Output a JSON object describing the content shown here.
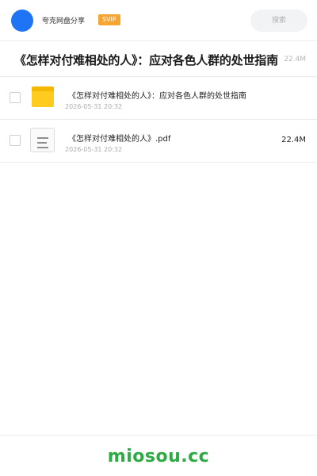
{
  "header": {
    "brand": "夸克网盘分享",
    "badge": "SVIP",
    "search_placeholder": "搜索"
  },
  "share": {
    "title": "《怎样对付难相处的人》：应对各色人群的处世指南",
    "total_size": "22.4M"
  },
  "files": [
    {
      "name": "《怎样对付难相处的人》：应对各色人群的处世指南",
      "date": "2026-05-31 20:32",
      "size": "",
      "type": "folder"
    },
    {
      "name": "《怎样对付难相处的人》.pdf",
      "date": "2026-05-31 20:32",
      "size": "22.4M",
      "type": "document"
    }
  ],
  "footer": {
    "watermark": "miosou.cc"
  },
  "colors": {
    "accent": "#1f74f6",
    "badge": "#f7a531",
    "folder": "#ffcb1f",
    "watermark": "#2eaa44"
  }
}
